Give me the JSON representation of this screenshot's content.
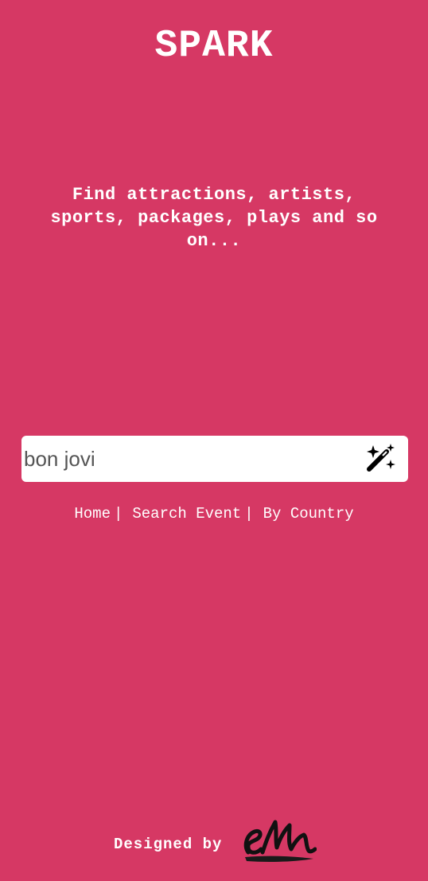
{
  "app": {
    "title": "SPARK",
    "tagline": "Find attractions, artists, sports, packages, plays and so on..."
  },
  "search": {
    "value": "bon jovi",
    "button_icon": "magic-wand-icon"
  },
  "nav": {
    "items": [
      {
        "label": "Home"
      },
      {
        "label": "Search Event"
      },
      {
        "label": "By Country"
      }
    ],
    "separator": "|"
  },
  "footer": {
    "text": "Designed by",
    "logo_text": "em"
  },
  "colors": {
    "background": "#D63864",
    "text": "#FFFFFF",
    "input_bg": "#FFFFFF",
    "input_text": "#555555",
    "icon": "#000000"
  }
}
